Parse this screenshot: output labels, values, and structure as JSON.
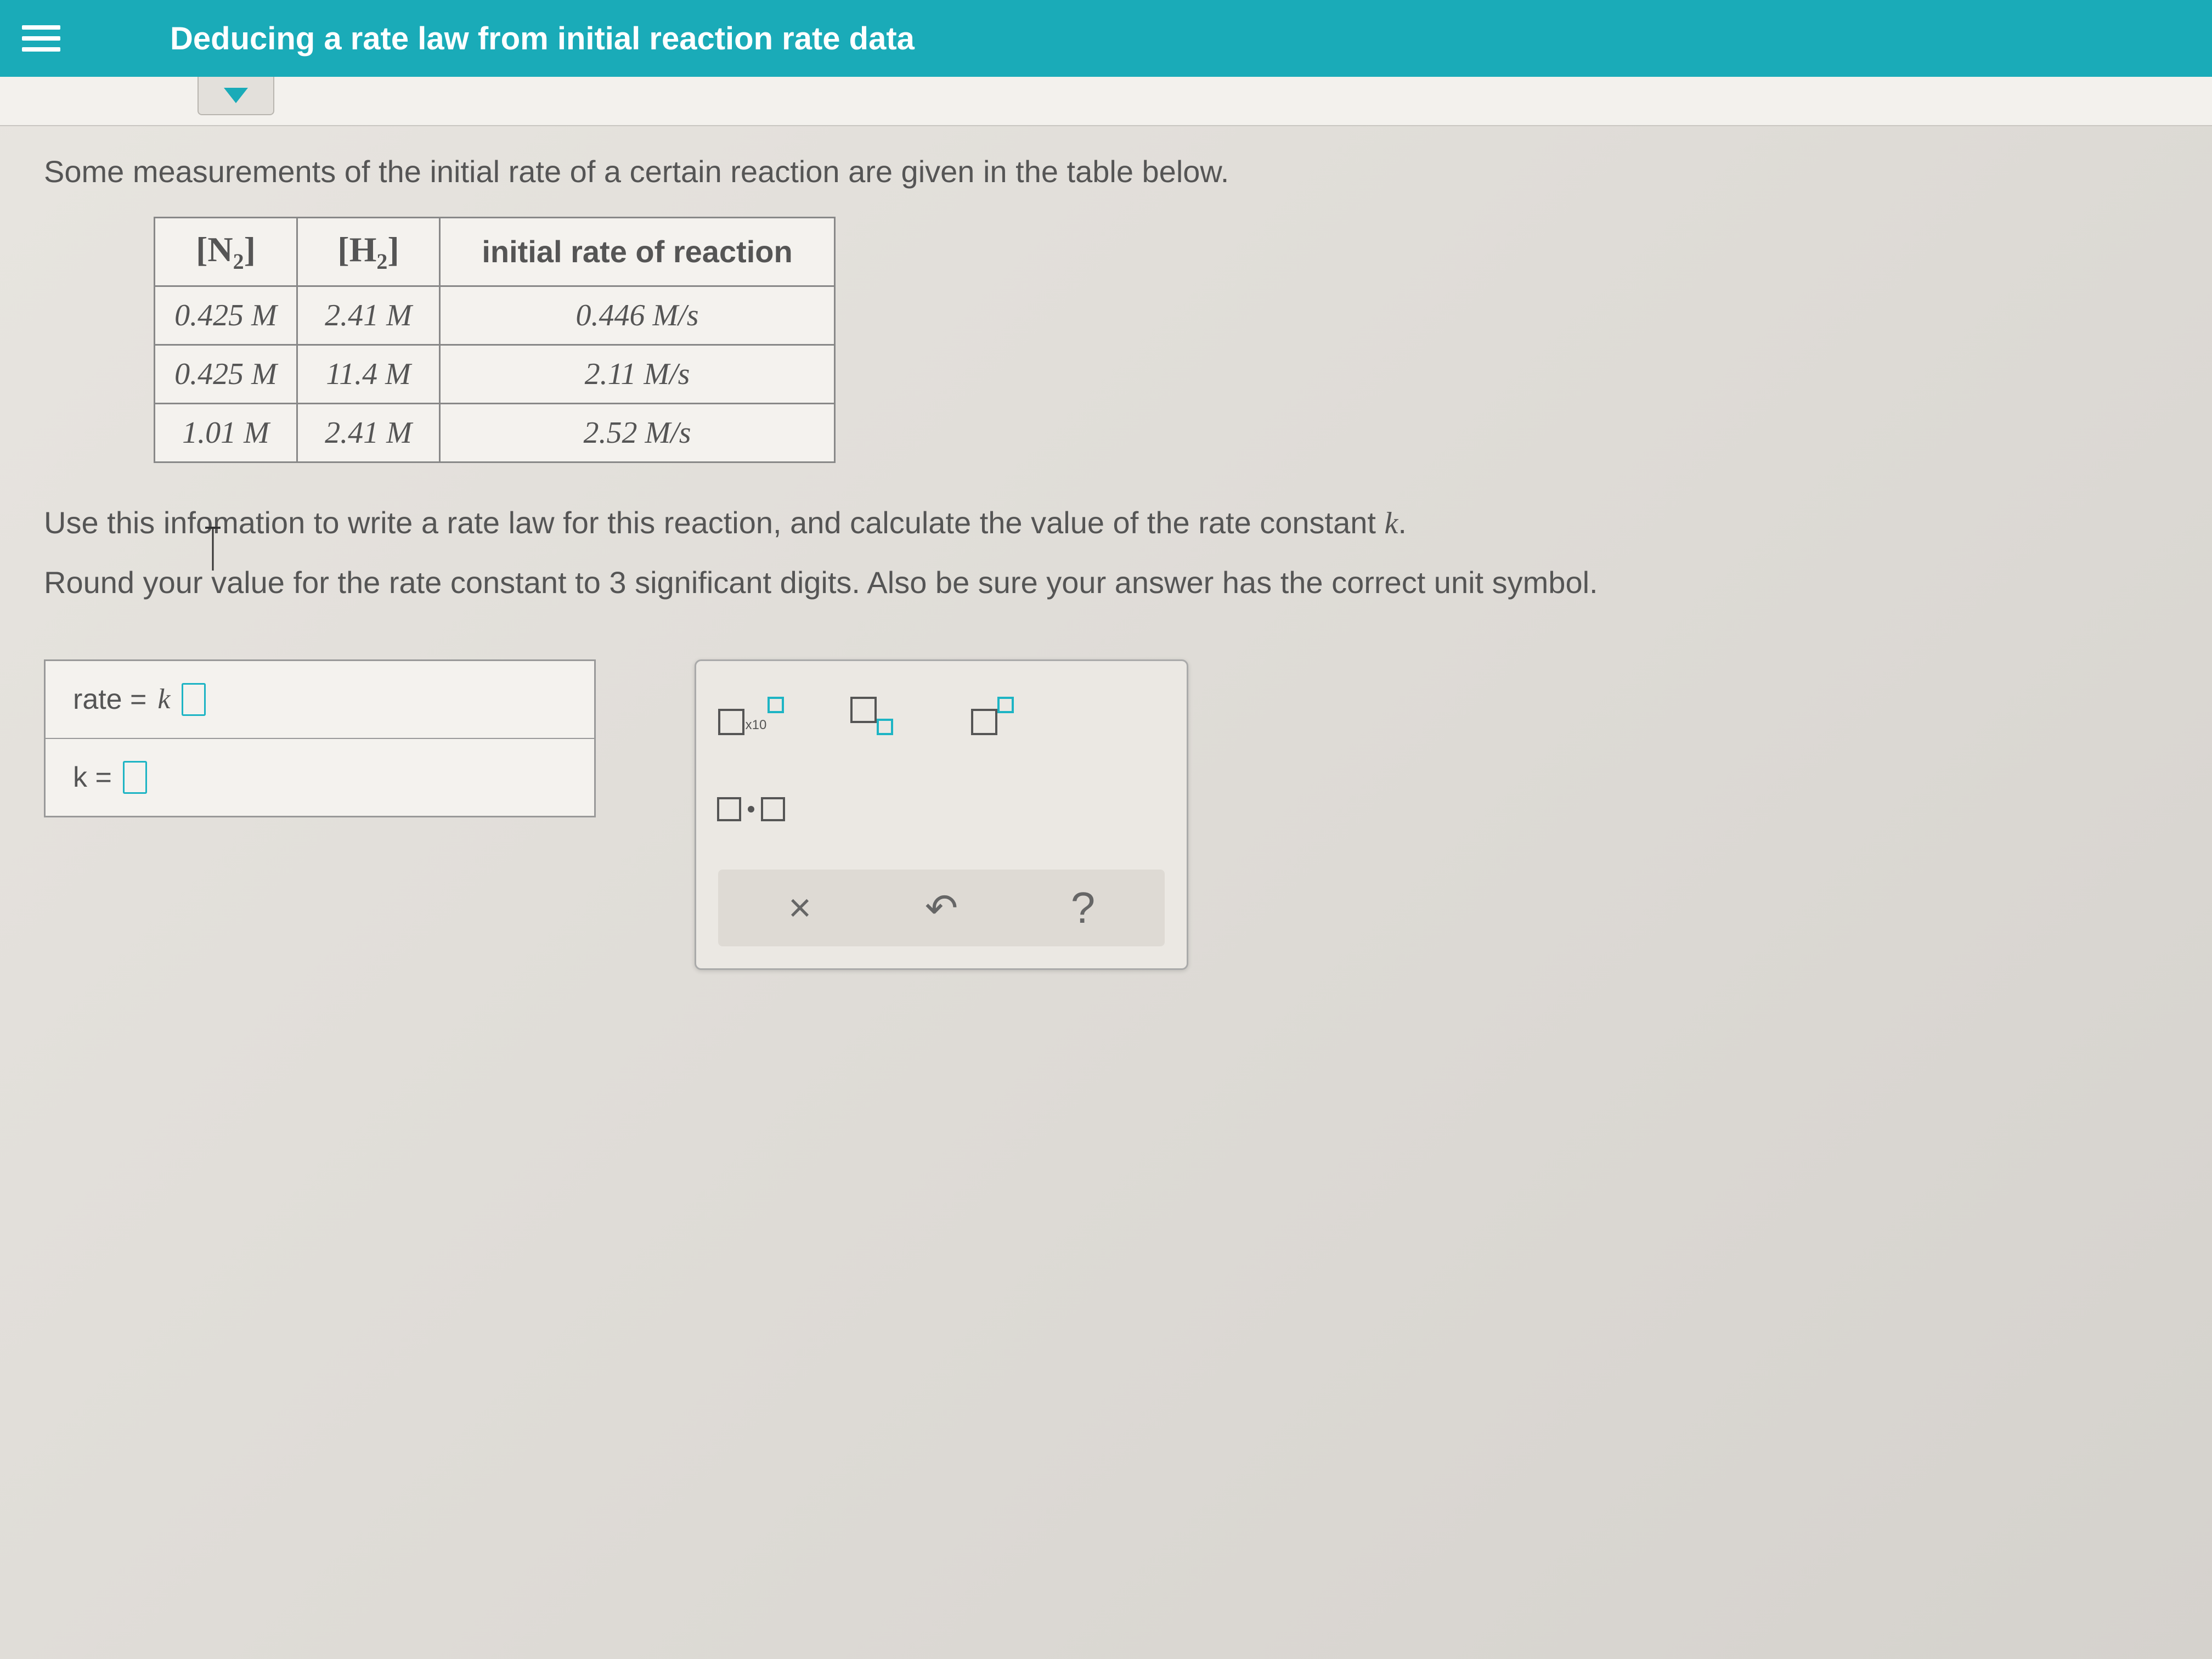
{
  "header": {
    "title": "Deducing a rate law from initial reaction rate data"
  },
  "intro": "Some measurements of the initial rate of a certain reaction are given in the table below.",
  "table": {
    "headers": {
      "col1_species": "N",
      "col1_sub": "2",
      "col2_species": "H",
      "col2_sub": "2",
      "col3": "initial rate of reaction"
    },
    "rows": [
      {
        "n2": "0.425 M",
        "h2": "2.41 M",
        "rate": "0.446 M/s"
      },
      {
        "n2": "0.425 M",
        "h2": "11.4 M",
        "rate": "2.11 M/s"
      },
      {
        "n2": "1.01 M",
        "h2": "2.41 M",
        "rate": "2.52 M/s"
      }
    ]
  },
  "instructions": {
    "line1_a": "Use this info",
    "line1_b": "mation to write a rate law for this reaction, and calculate the value of the rate constant ",
    "line1_k": "k",
    "line1_c": ".",
    "line2": "Round your value for the rate constant to 3 significant digits. Also be sure your answer has the correct unit symbol."
  },
  "answers": {
    "rate_label": "rate = ",
    "rate_k": "k",
    "k_label": "k = "
  },
  "tools": {
    "x10": "x10"
  },
  "controls": {
    "clear": "×",
    "undo": "↶",
    "help": "?"
  }
}
